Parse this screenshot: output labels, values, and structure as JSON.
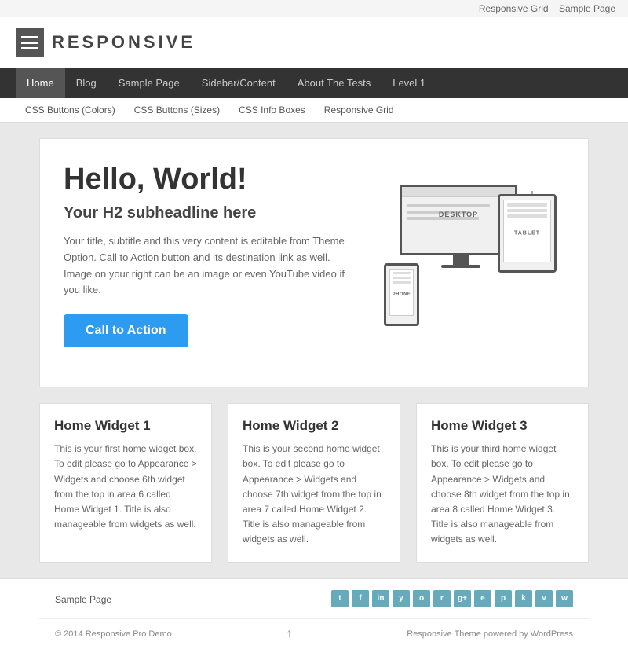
{
  "topbar": {
    "links": [
      "Responsive Grid",
      "Sample Page"
    ]
  },
  "header": {
    "logo_text": "RESPONSIVE"
  },
  "main_nav": {
    "items": [
      {
        "label": "Home",
        "active": true
      },
      {
        "label": "Blog"
      },
      {
        "label": "Sample Page"
      },
      {
        "label": "Sidebar/Content"
      },
      {
        "label": "About The Tests"
      },
      {
        "label": "Level 1"
      }
    ]
  },
  "sub_nav": {
    "items": [
      {
        "label": "CSS Buttons (Colors)"
      },
      {
        "label": "CSS Buttons (Sizes)"
      },
      {
        "label": "CSS Info Boxes"
      },
      {
        "label": "Responsive Grid"
      }
    ]
  },
  "hero": {
    "headline": "Hello, World!",
    "subheadline": "Your H2 subheadline here",
    "body": "Your title, subtitle and this very content is editable from Theme Option. Call to Action button and its destination link as well. Image on your right can be an image or even YouTube video if you like.",
    "cta_label": "Call to Action",
    "device_labels": {
      "desktop": "DESKTOP",
      "tablet": "TABLET",
      "phone": "PHONE"
    }
  },
  "widgets": [
    {
      "title": "Home Widget 1",
      "body": "This is your first home widget box. To edit please go to Appearance > Widgets and choose 6th widget from the top in area 6 called Home Widget 1. Title is also manageable from widgets as well."
    },
    {
      "title": "Home Widget 2",
      "body": "This is your second home widget box. To edit please go to Appearance > Widgets and choose 7th widget from the top in area 7 called Home Widget 2. Title is also manageable from widgets as well."
    },
    {
      "title": "Home Widget 3",
      "body": "This is your third home widget box. To edit please go to Appearance > Widgets and choose 8th widget from the top in area 8 called Home Widget 3. Title is also manageable from widgets as well."
    }
  ],
  "footer": {
    "nav_label": "Sample Page",
    "credits": "Responsive Theme powered by WordPress",
    "copyright": "© 2014 Responsive Pro Demo",
    "social_icons": [
      "t",
      "f",
      "in",
      "y",
      "o",
      "r",
      "g+",
      "e",
      "p",
      "k",
      "v",
      "w"
    ]
  }
}
